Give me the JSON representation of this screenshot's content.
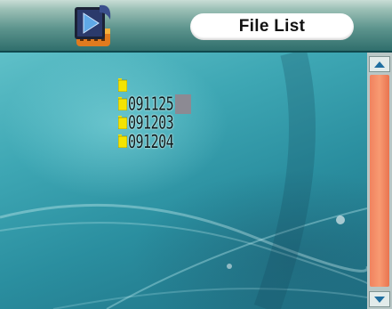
{
  "header": {
    "app_icon": "video-folder-icon",
    "title": "File List"
  },
  "file_list": {
    "items": [
      {
        "name": "",
        "icon": "folder-icon"
      },
      {
        "name": "091125",
        "icon": "folder-icon",
        "selected": true
      },
      {
        "name": "091203",
        "icon": "folder-icon"
      },
      {
        "name": "091204",
        "icon": "folder-icon"
      }
    ]
  },
  "scrollbar": {
    "up_icon": "arrow-up-icon",
    "down_icon": "arrow-down-icon"
  },
  "colors": {
    "scroll_thumb": "#f0835f",
    "selection": "#8c8a93",
    "folder": "#f4e400"
  }
}
